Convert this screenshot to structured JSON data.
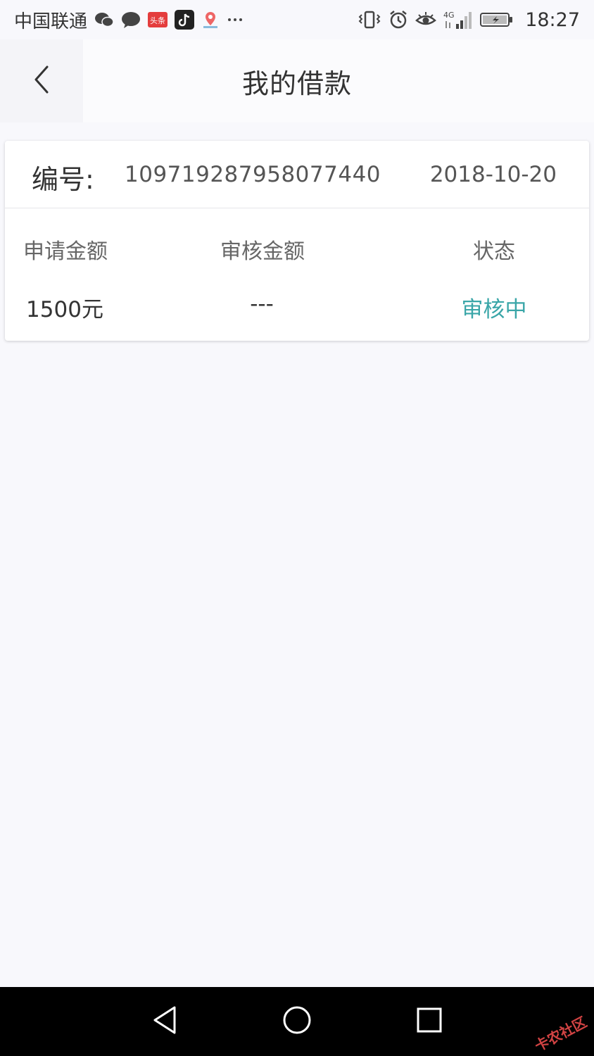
{
  "status_bar": {
    "carrier": "中国联通",
    "network": "4G",
    "time": "18:27",
    "icons": [
      "wechat-icon",
      "message-icon",
      "toutiao-icon",
      "tiktok-icon",
      "map-icon",
      "more-icon",
      "vibrate-icon",
      "alarm-icon",
      "eye-icon",
      "signal-icon",
      "battery-icon"
    ],
    "toutiao_label": "头条"
  },
  "header": {
    "title": "我的借款",
    "back_icon": "chevron-left-icon"
  },
  "loan_card": {
    "id_label": "编号:",
    "id_value": "109719287958077440",
    "date": "2018-10-20",
    "columns": [
      {
        "header": "申请金额",
        "value": "1500元"
      },
      {
        "header": "审核金额",
        "value": "---"
      },
      {
        "header": "状态",
        "value": "审核中"
      }
    ]
  },
  "nav_bar": {
    "back": "triangle-back-icon",
    "home": "circle-home-icon",
    "recents": "square-recents-icon"
  },
  "watermark": "卡农社区",
  "colors": {
    "background": "#f8f8fc",
    "status_accent": "#3aa6a8",
    "nav_bar": "#000000"
  }
}
